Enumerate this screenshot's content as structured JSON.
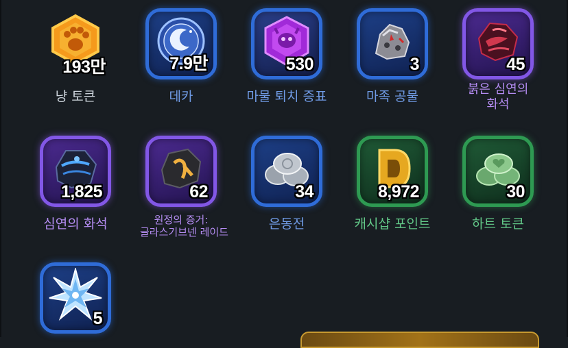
{
  "items": [
    {
      "name": "냥 토큰",
      "count": "193만",
      "frame": "none",
      "icon": "paw-token-icon",
      "name_color": "white"
    },
    {
      "name": "데카",
      "count": "7.9만",
      "frame": "blue",
      "icon": "deca-coin-icon",
      "name_color": "blue"
    },
    {
      "name": "마물 퇴치 증표",
      "count": "530",
      "frame": "purple",
      "icon": "monster-emblem-icon",
      "name_color": "blue"
    },
    {
      "name": "마족 공물",
      "count": "3",
      "frame": "blue",
      "icon": "demon-offering-icon",
      "name_color": "blue"
    },
    {
      "name_lines": [
        "붉은 심연의",
        "화석"
      ],
      "count": "45",
      "frame": "purple",
      "icon": "red-abyss-fossil-icon",
      "name_color": "purple"
    },
    {
      "name": "심연의 화석",
      "count": "1,825",
      "frame": "purple",
      "icon": "abyss-fossil-icon",
      "name_color": "purple"
    },
    {
      "name_lines": [
        "원정의 증거:",
        "글라스기브넨 레이드"
      ],
      "count": "62",
      "frame": "purple",
      "icon": "expedition-proof-icon",
      "name_color": "purple"
    },
    {
      "name": "은동전",
      "count": "34",
      "frame": "blue",
      "icon": "silver-coins-icon",
      "name_color": "blue"
    },
    {
      "name": "캐시샵 포인트",
      "count": "8,972",
      "frame": "green",
      "icon": "cashshop-point-icon",
      "name_color": "green"
    },
    {
      "name": "하트 토큰",
      "count": "30",
      "frame": "green",
      "icon": "heart-token-icon",
      "name_color": "green"
    },
    {
      "name": "",
      "count": "5",
      "frame": "blue",
      "icon": "star-crystal-icon",
      "name_color": "blue"
    }
  ],
  "colors": {
    "blue_frame": "#2f6cd8",
    "purple_frame": "#8257e6",
    "green_frame": "#2e9a52",
    "background": "#181d22"
  }
}
